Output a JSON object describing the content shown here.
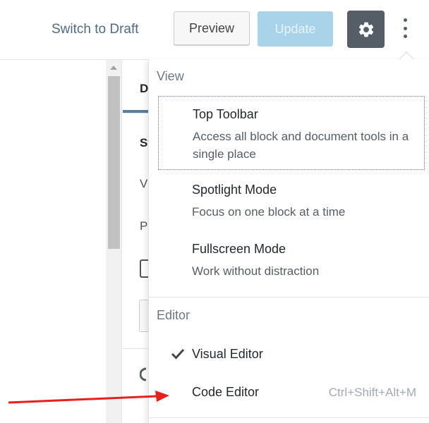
{
  "header": {
    "switch_to_draft": "Switch to Draft",
    "preview": "Preview",
    "update": "Update",
    "settings_icon": "gear-icon",
    "more_icon": "more-vertical-icon"
  },
  "sidebar": {
    "tab_fragment": "D",
    "row1_fragment": "St",
    "row2_fragment": "V",
    "row3_fragment": "P"
  },
  "menu": {
    "view_group": {
      "label": "View",
      "items": [
        {
          "label": "Top Toolbar",
          "description": "Access all block and document tools in a single place"
        },
        {
          "label": "Spotlight Mode",
          "description": "Focus on one block at a time"
        },
        {
          "label": "Fullscreen Mode",
          "description": "Work without distraction"
        }
      ]
    },
    "editor_group": {
      "label": "Editor",
      "items": [
        {
          "label": "Visual Editor",
          "checked": true,
          "icon": "checkmark-icon"
        },
        {
          "label": "Code Editor",
          "shortcut": "Ctrl+Shift+Alt+M"
        }
      ]
    }
  },
  "colors": {
    "accent_update": "#a9d3e8",
    "settings_bg": "#555d66",
    "annotation_arrow": "#e8201c"
  }
}
